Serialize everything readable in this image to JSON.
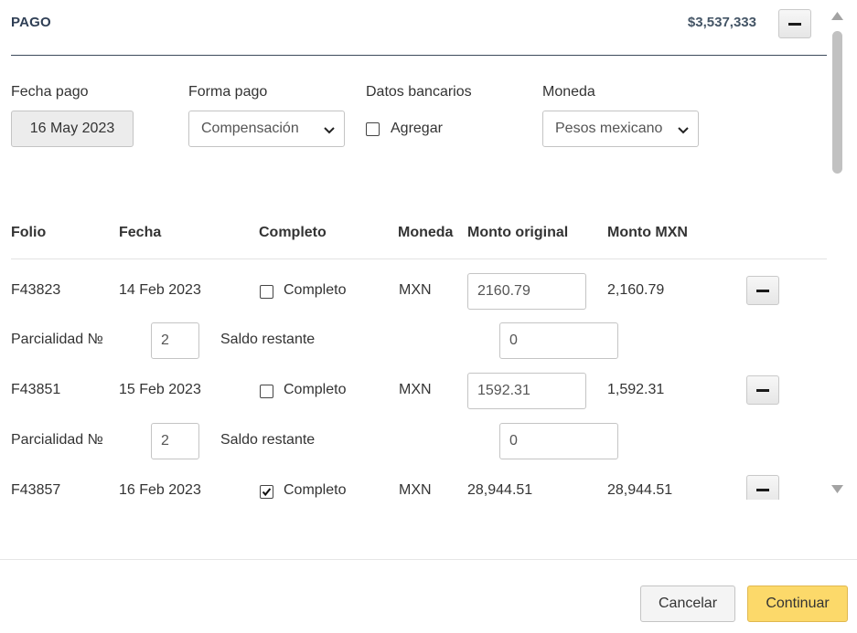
{
  "header": {
    "title": "PAGO",
    "total": "$3,537,333"
  },
  "form": {
    "fecha_pago": {
      "label": "Fecha pago",
      "value": "16 May 2023"
    },
    "forma_pago": {
      "label": "Forma pago",
      "value": "Compensación"
    },
    "datos_bancarios": {
      "label": "Datos bancarios",
      "checkbox_label": "Agregar",
      "checked": false
    },
    "moneda": {
      "label": "Moneda",
      "value": "Pesos mexicano"
    }
  },
  "table": {
    "headers": {
      "folio": "Folio",
      "fecha": "Fecha",
      "completo": "Completo",
      "moneda": "Moneda",
      "monto_original": "Monto original",
      "monto_mxn": "Monto MXN"
    },
    "rows": [
      {
        "folio": "F43823",
        "fecha": "14 Feb 2023",
        "completo_label": "Completo",
        "completo": false,
        "moneda": "MXN",
        "monto_original": "2160.79",
        "monto_mxn": "2,160.79",
        "parcialidad_label": "Parcialidad №",
        "parcialidad": "2",
        "saldo_label": "Saldo restante",
        "saldo": "0"
      },
      {
        "folio": "F43851",
        "fecha": "15 Feb 2023",
        "completo_label": "Completo",
        "completo": false,
        "moneda": "MXN",
        "monto_original": "1592.31",
        "monto_mxn": "1,592.31",
        "parcialidad_label": "Parcialidad №",
        "parcialidad": "2",
        "saldo_label": "Saldo restante",
        "saldo": "0"
      },
      {
        "folio": "F43857",
        "fecha": "16 Feb 2023",
        "completo_label": "Completo",
        "completo": true,
        "moneda": "MXN",
        "monto_original": "28,944.51",
        "monto_mxn": "28,944.51"
      }
    ]
  },
  "footer": {
    "cancel_label": "Cancelar",
    "continue_label": "Continuar"
  },
  "colors": {
    "primary_button": "#fcd96a",
    "header_text": "#2f3f55"
  }
}
